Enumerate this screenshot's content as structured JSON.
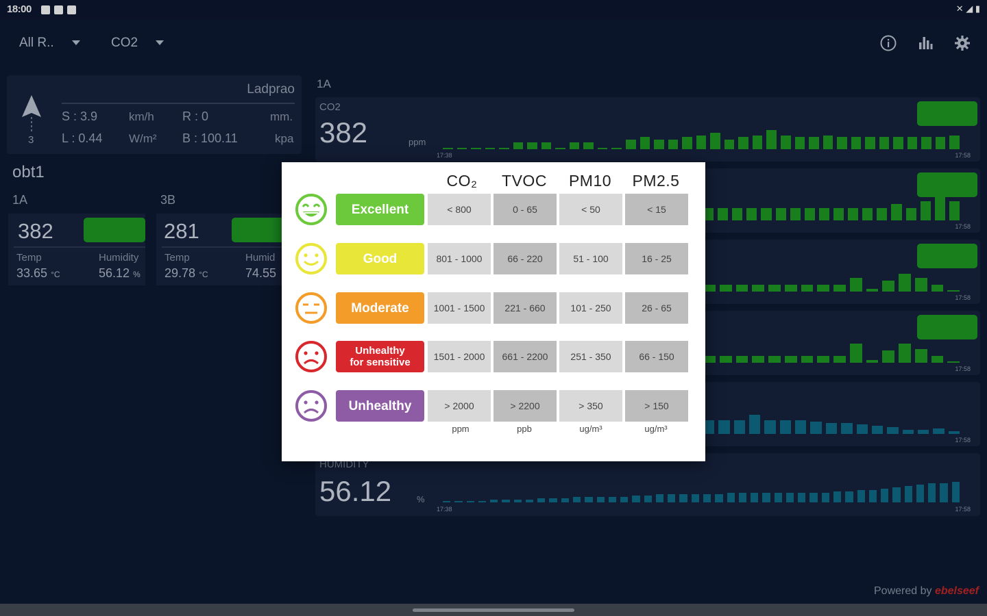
{
  "status": {
    "time": "18:00",
    "icons": [
      "image-icon",
      "photo-icon",
      "google-icon"
    ],
    "right": "✕ ◢ ▮"
  },
  "appbar": {
    "dropdown1": "All R..",
    "dropdown2": "CO2"
  },
  "weather": {
    "location": "Ladprao",
    "direction_label": "3",
    "speed": "S : 3.9",
    "speed_unit": "km/h",
    "rain": "R : 0",
    "rain_unit": "mm.",
    "light": "L : 0.44",
    "light_unit": "W/m²",
    "baro": "B : 100.11",
    "baro_unit": "kpa"
  },
  "section": {
    "title": "obt1"
  },
  "cards": [
    {
      "room": "1A",
      "value": "382",
      "temp_label": "Temp",
      "temp_value": "33.65",
      "temp_unit": "°C",
      "hum_label": "Humidity",
      "hum_value": "56.12",
      "hum_unit": "%"
    },
    {
      "room": "3B",
      "value": "281",
      "temp_label": "Temp",
      "temp_value": "29.78",
      "temp_unit": "°C",
      "hum_label": "Humid",
      "hum_value": "74.55",
      "hum_unit": ""
    }
  ],
  "right_panel": {
    "room": "1A"
  },
  "charts": {
    "co2": {
      "name": "CO2",
      "value": "382",
      "unit": "ppm",
      "t_start": "17:38",
      "t_end": "17:58"
    },
    "humidity": {
      "name": "HUMIDITY",
      "value": "56.12",
      "unit": "%",
      "t_start": "17:38",
      "t_end": "17:58"
    },
    "hidden_t_end": [
      "17:58",
      "17:58",
      "17:58",
      "17:58"
    ]
  },
  "modal": {
    "headers": [
      "CO₂",
      "TVOC",
      "PM10",
      "PM2.5"
    ],
    "rows": [
      {
        "label": "Excellent",
        "color": "#6cc93c",
        "face": "laugh",
        "face_color": "#6cc93c",
        "values": [
          "< 800",
          "0 - 65",
          "< 50",
          "< 15"
        ]
      },
      {
        "label": "Good",
        "color": "#e9e63a",
        "face": "smile",
        "face_color": "#e9e63a",
        "values": [
          "801 - 1000",
          "66 - 220",
          "51 - 100",
          "16 - 25"
        ]
      },
      {
        "label": "Moderate",
        "color": "#f39c2a",
        "face": "neutral",
        "face_color": "#f39c2a",
        "values": [
          "1001 - 1500",
          "221 - 660",
          "101 - 250",
          "26 - 65"
        ]
      },
      {
        "label": "Unhealthy\nfor sensitive",
        "color": "#d9272e",
        "face": "sad",
        "face_color": "#d9272e",
        "values": [
          "1501 - 2000",
          "661 - 2200",
          "251 - 350",
          "66 - 150"
        ]
      },
      {
        "label": "Unhealthy",
        "color": "#8e5ca5",
        "face": "sad",
        "face_color": "#8e5ca5",
        "values": [
          "> 2000",
          "> 2200",
          "> 350",
          "> 150"
        ]
      }
    ],
    "units": [
      "ppm",
      "ppb",
      "ug/m³",
      "ug/m³"
    ]
  },
  "footer": {
    "powered": "Powered by",
    "brand": "ebelseef"
  },
  "colors": {
    "good_green": "#1f9b24",
    "humidity_blue": "#0e6e8c"
  }
}
